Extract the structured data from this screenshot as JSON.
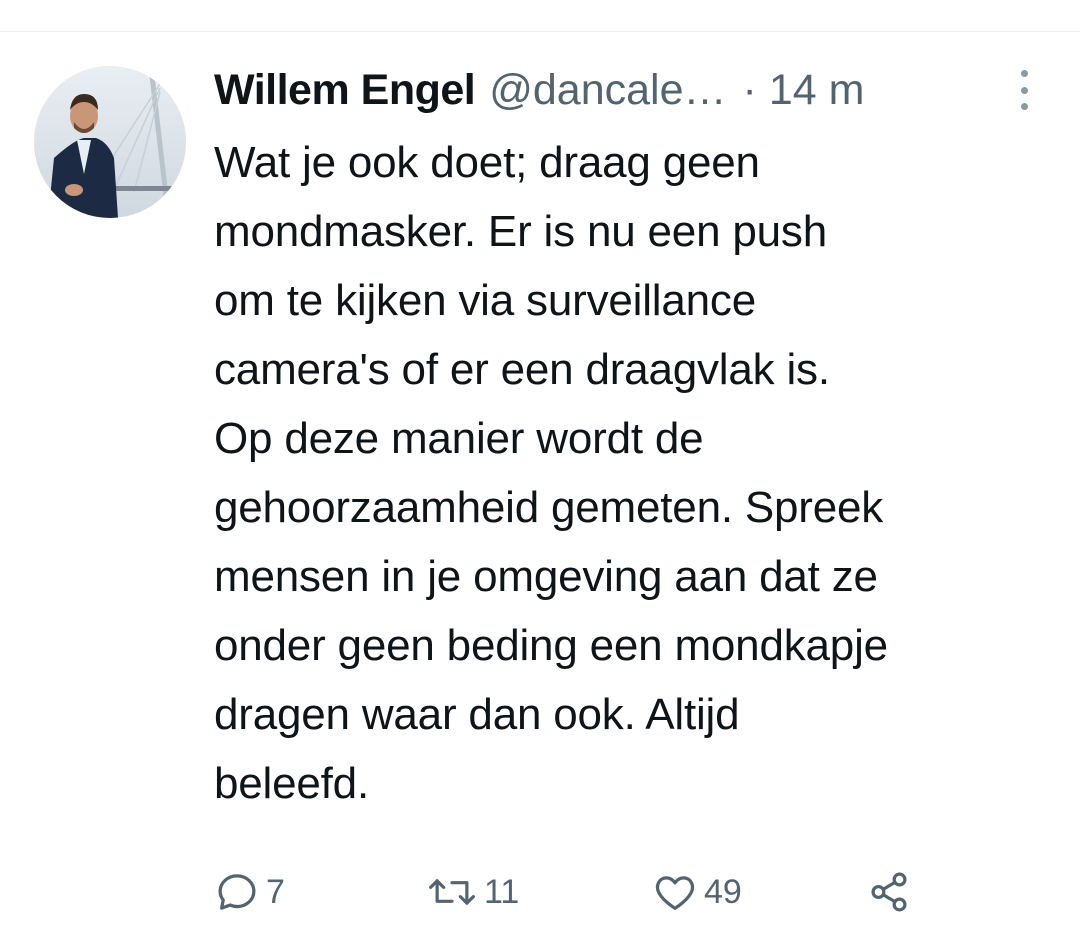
{
  "tweet": {
    "author": {
      "display_name": "Willem Engel",
      "handle": "@dancale…",
      "avatar_icon": "profile-photo"
    },
    "separator": "·",
    "timestamp": "14 m",
    "more_icon": "more-options-icon",
    "text": "Wat je ook doet; draag geen\nmondmasker. Er is nu een push\nom te kijken via surveillance\ncamera's of er een draagvlak is.\nOp deze manier wordt de\ngehoorzaamheid gemeten. Spreek\nmensen in je omgeving aan dat ze\nonder geen beding een mondkapje\ndragen waar dan ook. Altijd\nbeleefd.",
    "actions": {
      "reply_count": "7",
      "retweet_count": "11",
      "like_count": "49"
    }
  },
  "colors": {
    "text_primary": "#0f1419",
    "text_secondary": "#536471",
    "divider": "#eff3f4"
  }
}
